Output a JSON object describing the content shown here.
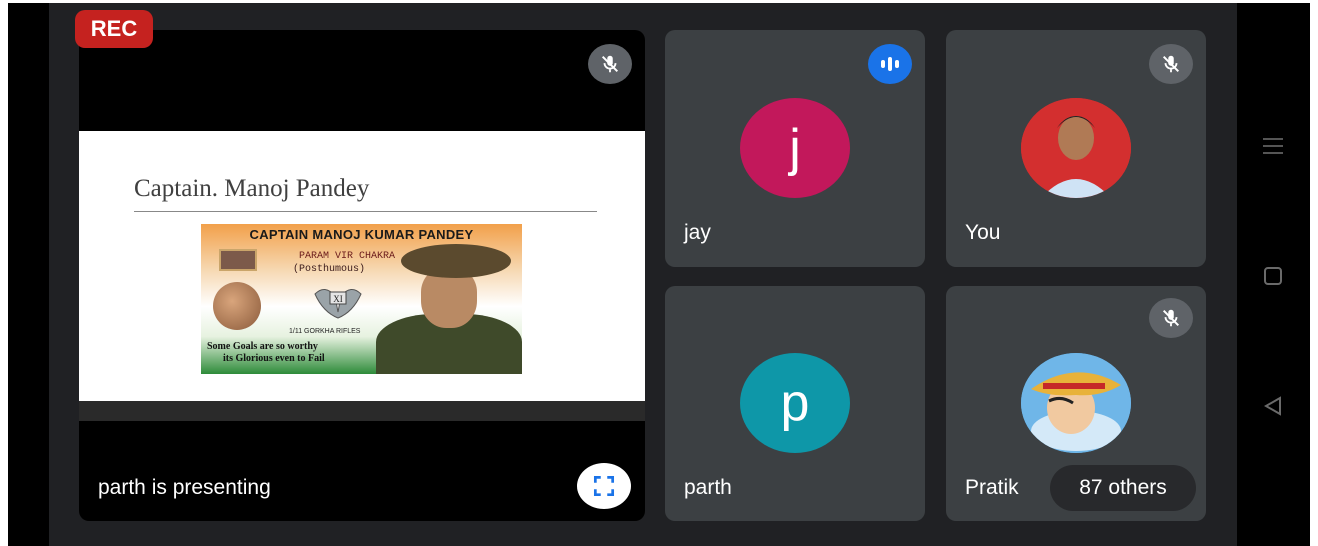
{
  "recording": {
    "label": "REC",
    "color": "#c5221f"
  },
  "presenter_tile": {
    "label": "parth is presenting",
    "mic_state": "muted",
    "fullscreen_icon": "fullscreen-icon",
    "slide": {
      "title": "Captain. Manoj Pandey",
      "poster": {
        "heading": "CAPTAIN MANOJ KUMAR PANDEY",
        "award": "PARAM VIR CHAKRA",
        "award_note": "(Posthumous)",
        "emblem_text": "XI",
        "unit": "1/11 GORKHA RIFLES",
        "quote_line1": "Some Goals are so worthy",
        "quote_line2": "its Glorious even to Fail"
      }
    }
  },
  "participants": [
    {
      "name": "jay",
      "initial": "j",
      "avatar_color": "#c2185b",
      "status_icon": "speaking-icon"
    },
    {
      "name": "You",
      "initial": "",
      "avatar_color": "#d32f2f",
      "status_icon": "mic-off-icon"
    },
    {
      "name": "parth",
      "initial": "p",
      "avatar_color": "#0e97a8",
      "status_icon": ""
    },
    {
      "name": "Pratik",
      "initial": "",
      "avatar_color": "#4aa3df",
      "status_icon": "mic-off-icon"
    }
  ],
  "others": {
    "label": "87 others"
  },
  "navigation": {
    "menu_icon": "menu-icon",
    "home_icon": "square-icon",
    "back_icon": "back-triangle-icon"
  },
  "colors": {
    "background": "#202124",
    "tile": "#3c4043",
    "accent_speaking": "#1a73e8"
  }
}
